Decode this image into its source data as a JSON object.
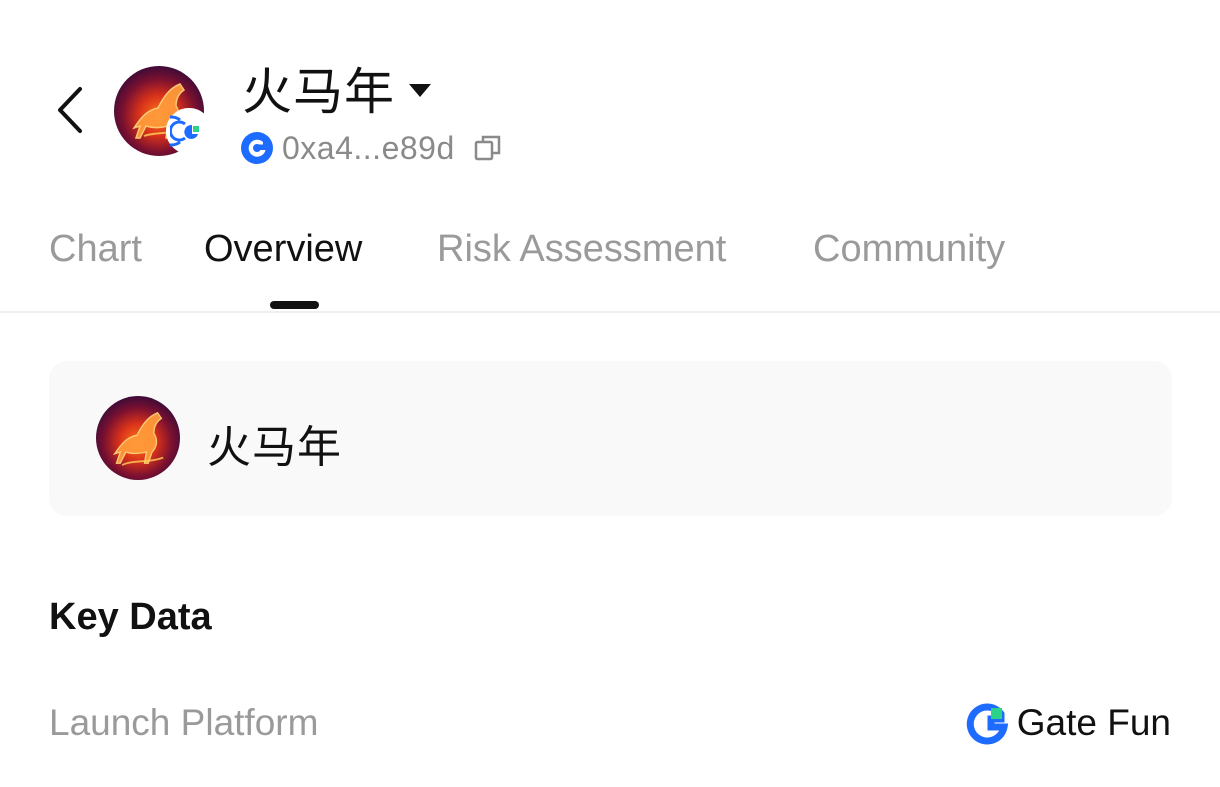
{
  "header": {
    "token_name": "火马年",
    "address": "0xa4...e89d",
    "accent_color": "#1e6bff",
    "green_accent": "#2bd38a"
  },
  "tabs": [
    {
      "label": "Chart",
      "active": false
    },
    {
      "label": "Overview",
      "active": true
    },
    {
      "label": "Risk Assessment",
      "active": false
    },
    {
      "label": "Community",
      "active": false
    }
  ],
  "token_card": {
    "name": "火马年"
  },
  "key_data": {
    "title": "Key Data",
    "rows": [
      {
        "label": "Launch Platform",
        "value": "Gate Fun",
        "icon": "gate-fun-logo-icon"
      }
    ]
  }
}
